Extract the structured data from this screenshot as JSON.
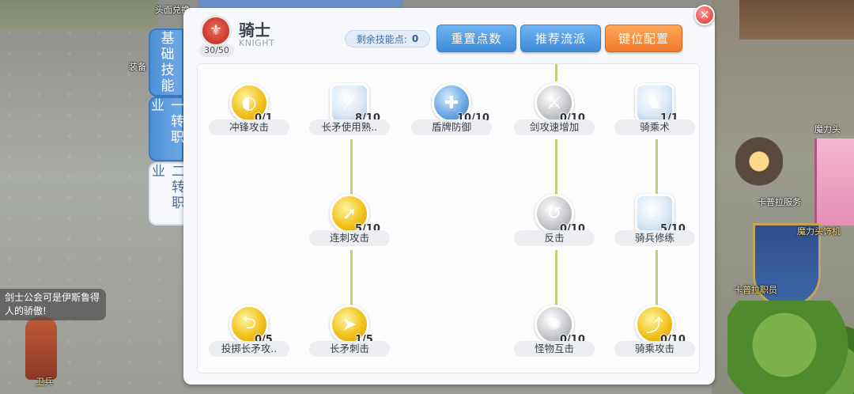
{
  "world": {
    "tags": [
      "头面兑换",
      "装备",
      "魔力头",
      "卡普拉服务",
      "魔力头饰机",
      "卡普拉职员",
      "装",
      "卫兵"
    ],
    "chat_lines": [
      "剑士公会可是伊斯鲁得",
      "人的骄傲!"
    ]
  },
  "tabs": [
    {
      "label": "基础技能",
      "active": false
    },
    {
      "label": "一转职业",
      "active": false
    },
    {
      "label": "二转职业",
      "active": true
    }
  ],
  "header": {
    "job_level": "30/50",
    "job_title": "骑士",
    "job_subtitle": "KNIGHT",
    "points_label": "剩余技能点:",
    "points_value": "0",
    "buttons": {
      "reset": "重置点数",
      "recommend": "推荐流派",
      "keybind": "键位配置"
    }
  },
  "close_label": "✕",
  "skills": [
    {
      "name": "冲锋攻击",
      "level": "0/1",
      "icon": "charge-attack-icon",
      "style": "gold"
    },
    {
      "name": "长矛使用熟..",
      "level": "8/10",
      "icon": "spear-mastery-icon",
      "style": "pale"
    },
    {
      "name": "盾牌防御",
      "level": "10/10",
      "icon": "shield-defense-icon",
      "style": "blue"
    },
    {
      "name": "剑攻速增加",
      "level": "0/10",
      "icon": "two-hand-quicken-icon",
      "style": "silver"
    },
    {
      "name": "骑乘术",
      "level": "1/1",
      "icon": "riding-icon",
      "style": "pale"
    },
    {
      "name": "连刺攻击",
      "level": "5/10",
      "icon": "pierce-icon",
      "style": "gold"
    },
    {
      "name": "反击",
      "level": "0/10",
      "icon": "counter-attack-icon",
      "style": "silver"
    },
    {
      "name": "骑兵修练",
      "level": "5/10",
      "icon": "cavalier-mastery-icon",
      "style": "pale"
    },
    {
      "name": "投掷长矛攻..",
      "level": "0/5",
      "icon": "spear-throw-icon",
      "style": "gold"
    },
    {
      "name": "长矛刺击",
      "level": "1/5",
      "icon": "spear-stab-icon",
      "style": "gold"
    },
    {
      "name": "怪物互击",
      "level": "0/10",
      "icon": "brandish-spear-icon",
      "style": "silver"
    },
    {
      "name": "骑乘攻击",
      "level": "0/10",
      "icon": "charge-riding-icon",
      "style": "gold"
    }
  ],
  "colors": {
    "tab_blue": "#4d8fd6",
    "btn_blue": "#3f8bd9",
    "btn_orange": "#f07a2a",
    "connector": "#b9d56d"
  }
}
